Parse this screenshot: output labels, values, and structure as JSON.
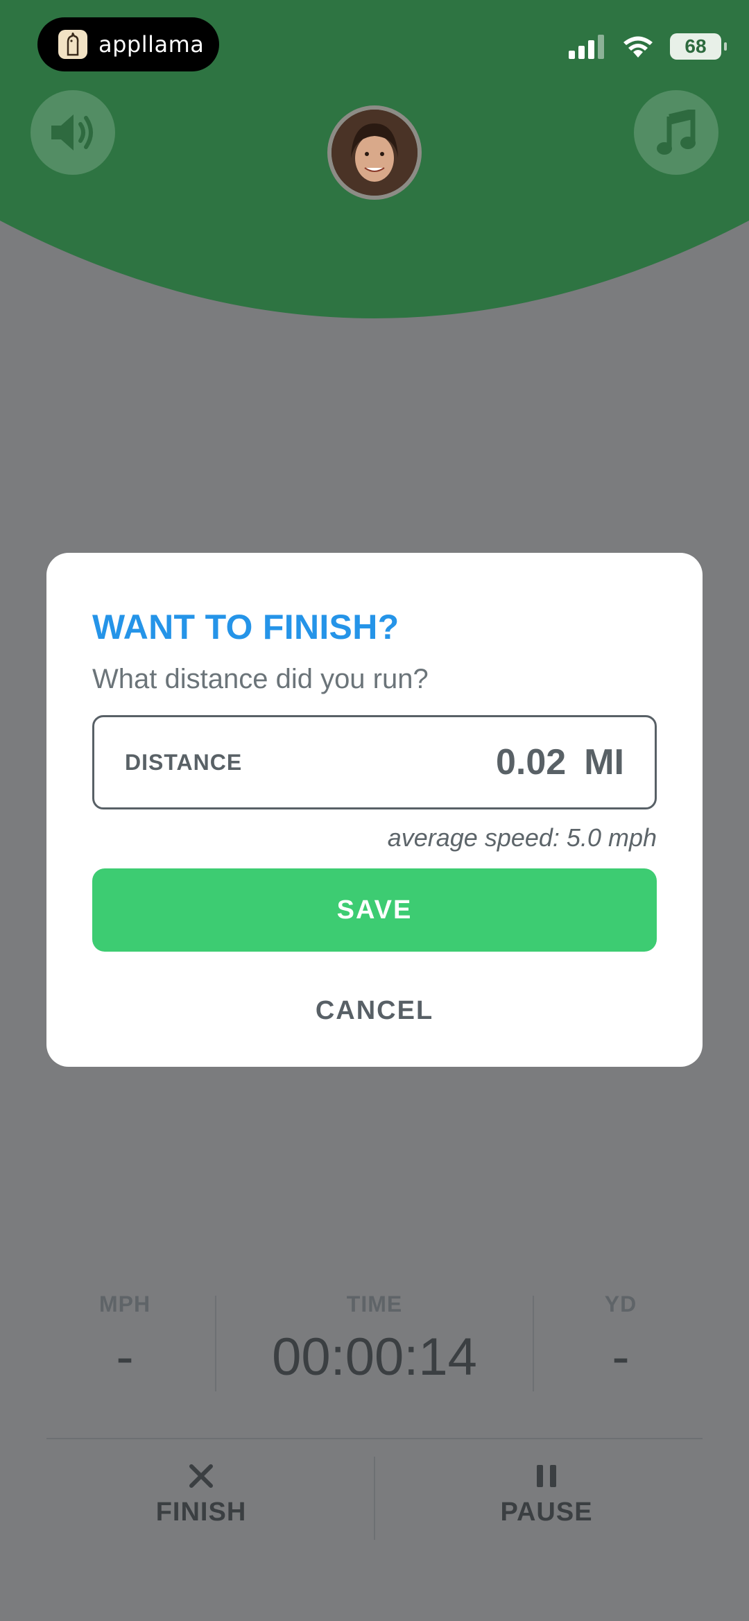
{
  "status_bar": {
    "app_badge": "appllama",
    "battery": "68"
  },
  "header": {
    "sound_icon": "speaker-icon",
    "music_icon": "music-note-icon"
  },
  "dialog": {
    "title": "WANT TO FINISH?",
    "subtitle": "What distance did you run?",
    "distance_label": "DISTANCE",
    "distance_value": "0.02",
    "distance_unit": "MI",
    "average_speed": "average speed: 5.0 mph",
    "save_label": "SAVE",
    "cancel_label": "CANCEL"
  },
  "stats": {
    "mph_label": "MPH",
    "mph_value": "-",
    "time_label": "TIME",
    "time_value": "00:00:14",
    "yd_label": "YD",
    "yd_value": "-"
  },
  "actions": {
    "finish_label": "FINISH",
    "pause_label": "PAUSE"
  },
  "colors": {
    "header_green": "#2e7442",
    "title_blue": "#2594e8",
    "save_green": "#3dcc72",
    "overlay_gray": "#7b7c7e"
  }
}
